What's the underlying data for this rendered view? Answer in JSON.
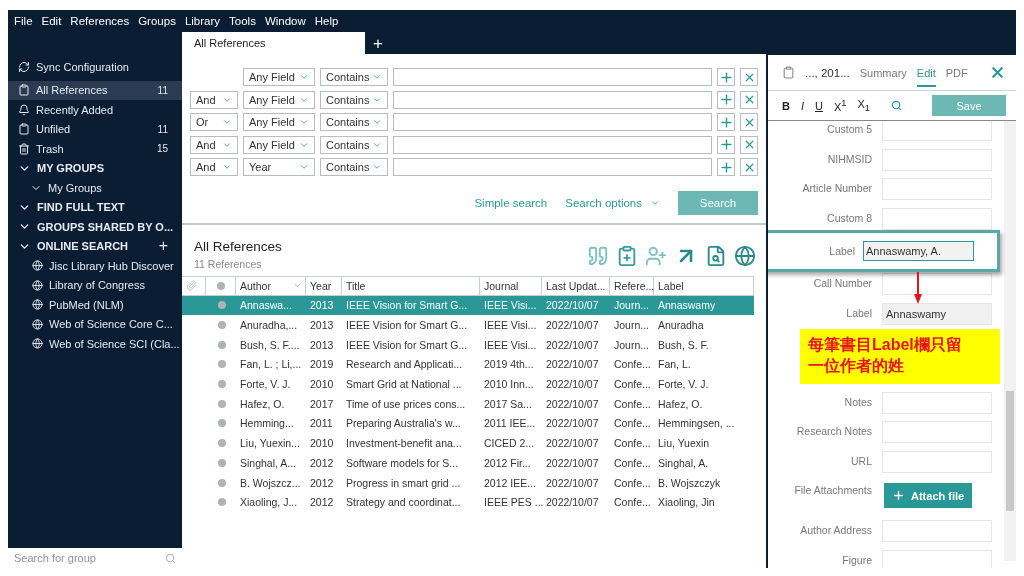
{
  "menu": [
    "File",
    "Edit",
    "References",
    "Groups",
    "Library",
    "Tools",
    "Window",
    "Help"
  ],
  "sidebar": {
    "items": [
      {
        "label": "Sync Configuration",
        "selected": false
      },
      {
        "label": "All References",
        "count": "11",
        "selected": true
      },
      {
        "label": "Recently Added",
        "selected": false
      },
      {
        "label": "Unfiled",
        "count": "11",
        "selected": false
      },
      {
        "label": "Trash",
        "count": "15",
        "selected": false
      }
    ],
    "sections": [
      {
        "title": "MY GROUPS",
        "expanded": true,
        "children": [
          {
            "label": "My Groups",
            "expanded": true
          }
        ]
      },
      {
        "title": "FIND FULL TEXT",
        "expanded": true
      },
      {
        "title": "GROUPS SHARED BY O...",
        "expanded": true
      },
      {
        "title": "ONLINE SEARCH",
        "expanded": true,
        "add": "+",
        "children": [
          {
            "label": "Jisc Library Hub Discover"
          },
          {
            "label": "Library of Congress"
          },
          {
            "label": "PubMed (NLM)"
          },
          {
            "label": "Web of Science Core C..."
          },
          {
            "label": "Web of Science SCI (Cla..."
          }
        ]
      }
    ],
    "search": {
      "placeholder": "Search for group"
    }
  },
  "tabs": [
    {
      "label": "All References",
      "selected": true
    }
  ],
  "tab_add": "+",
  "search_rows": [
    {
      "field": "Any Field",
      "operator": "Contains"
    },
    {
      "conjunction": "And",
      "field": "Any Field",
      "operator": "Contains"
    },
    {
      "conjunction": "Or",
      "field": "Any Field",
      "operator": "Contains"
    },
    {
      "conjunction": "And",
      "field": "Any Field",
      "operator": "Contains"
    },
    {
      "conjunction": "And",
      "field": "Year",
      "operator": "Contains"
    }
  ],
  "search_links": {
    "simple": "Simple search",
    "options": "Search options",
    "button": "Search"
  },
  "list": {
    "title": "All References",
    "count": "11 References"
  },
  "table": {
    "columns": [
      "Author",
      "Year",
      "Title",
      "Journal",
      "Last Updat...",
      "Refere...",
      "Label"
    ],
    "rows": [
      {
        "selected": true,
        "cells": [
          "Annaswa...",
          "2013",
          "IEEE Vision for Smart G...",
          "IEEE Visi...",
          "2022/10/07",
          "Journ...",
          "Annaswamy"
        ]
      },
      {
        "selected": false,
        "cells": [
          "Anuradha,...",
          "2013",
          "IEEE Vision for Smart G...",
          "IEEE Visi...",
          "2022/10/07",
          "Journ...",
          "Anuradha"
        ]
      },
      {
        "selected": false,
        "cells": [
          "Bush, S. F....",
          "2013",
          "IEEE Vision for Smart G...",
          "IEEE Visi...",
          "2022/10/07",
          "Journ...",
          "Bush, S. F."
        ]
      },
      {
        "selected": false,
        "cells": [
          "Fan, L. ; Li,...",
          "2019",
          "Research and Applicati...",
          "2019 4th...",
          "2022/10/07",
          "Confe...",
          "Fan, L."
        ]
      },
      {
        "selected": false,
        "cells": [
          "Forte, V. J.",
          "2010",
          "Smart Grid at National ...",
          "2010 Inn...",
          "2022/10/07",
          "Confe...",
          "Forte, V. J."
        ]
      },
      {
        "selected": false,
        "cells": [
          "Hafez, O.",
          "2017",
          "Time of use prices cons...",
          "2017 Sa...",
          "2022/10/07",
          "Confe...",
          "Hafez, O."
        ]
      },
      {
        "selected": false,
        "cells": [
          "Hemming...",
          "2011",
          "Preparing Australia's w...",
          "2011 IEE...",
          "2022/10/07",
          "Confe...",
          "Hemmingsen, ..."
        ]
      },
      {
        "selected": false,
        "cells": [
          "Liu, Yuexin...",
          "2010",
          "Investment-benefit ana...",
          "CICED 2...",
          "2022/10/07",
          "Confe...",
          "Liu, Yuexin"
        ]
      },
      {
        "selected": false,
        "cells": [
          "Singhal, A...",
          "2012",
          "Software models for S...",
          "2012 Fir...",
          "2022/10/07",
          "Confe...",
          "Singhal, A."
        ]
      },
      {
        "selected": false,
        "cells": [
          "B. Wojszcz...",
          "2012",
          "Progress in smart grid ...",
          "2012 IEE...",
          "2022/10/07",
          "Confe...",
          "B. Wojszczyk"
        ]
      },
      {
        "selected": false,
        "cells": [
          "Xiaoling, J...",
          "2012",
          "Strategy and coordinat...",
          "IEEE PES ...",
          "2022/10/07",
          "Confe...",
          "Xiaoling, Jin"
        ]
      }
    ]
  },
  "panel": {
    "title": "..., 201...",
    "tabs": [
      {
        "label": "Summary",
        "selected": false
      },
      {
        "label": "Edit",
        "selected": true
      },
      {
        "label": "PDF",
        "selected": false
      }
    ],
    "format": [
      "B",
      "I",
      "U",
      "X$^{1}$",
      "X$_{1}$"
    ],
    "save": "Save",
    "fields": [
      {
        "kind": "field",
        "label": "Custom 5"
      },
      {
        "kind": "field",
        "label": "NIHMSID"
      },
      {
        "kind": "field",
        "label": "Article Number"
      },
      {
        "kind": "field",
        "label": "Custom 8"
      },
      {
        "kind": "callout",
        "label": "Label",
        "value": "Annaswamy, A."
      },
      {
        "kind": "field",
        "label": "Call Number"
      },
      {
        "kind": "field",
        "label": "Label",
        "value": "Annaswamy"
      },
      {
        "kind": "note",
        "text": "每筆書目Label欄只留一位作者的姓"
      },
      {
        "kind": "field",
        "label": "Notes"
      },
      {
        "kind": "field",
        "label": "Research Notes"
      },
      {
        "kind": "field",
        "label": "URL"
      },
      {
        "kind": "attach",
        "label": "File Attachments",
        "button": "Attach file"
      },
      {
        "kind": "field",
        "label": "Author Address"
      },
      {
        "kind": "field",
        "label": "Figure"
      }
    ]
  }
}
